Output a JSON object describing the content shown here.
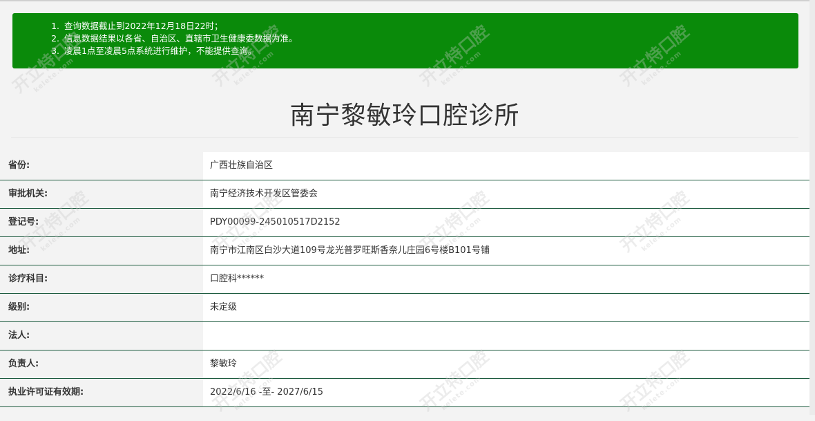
{
  "notice": {
    "items": [
      "查询数据截止到2022年12月18日22时；",
      "信息数据结果以各省、自治区、直辖市卫生健康委数据为准。",
      "凌晨1点至凌晨5点系统进行维护，不能提供查询。"
    ]
  },
  "clinic": {
    "name": "南宁黎敏玲口腔诊所"
  },
  "fields": [
    {
      "label": "省份:",
      "value": "广西壮族自治区"
    },
    {
      "label": "审批机关:",
      "value": "南宁经济技术开发区管委会"
    },
    {
      "label": "登记号:",
      "value": "PDY00099-245010517D2152"
    },
    {
      "label": "地址:",
      "value": "南宁市江南区白沙大道109号龙光普罗旺斯香奈儿庄园6号楼B101号铺"
    },
    {
      "label": "诊疗科目:",
      "value": "口腔科******"
    },
    {
      "label": "级别:",
      "value": "未定级"
    },
    {
      "label": "法人:",
      "value": ""
    },
    {
      "label": "负责人:",
      "value": "黎敏玲"
    },
    {
      "label": "执业许可证有效期:",
      "value": "2022/6/16 -至- 2027/6/15"
    }
  ],
  "watermark": {
    "text": "开立特口腔",
    "sub": "kelete.com"
  },
  "colors": {
    "notice_bg": "#0a8a0a",
    "row_border": "#1c5a3e",
    "page_bg": "#f3f3f3"
  }
}
